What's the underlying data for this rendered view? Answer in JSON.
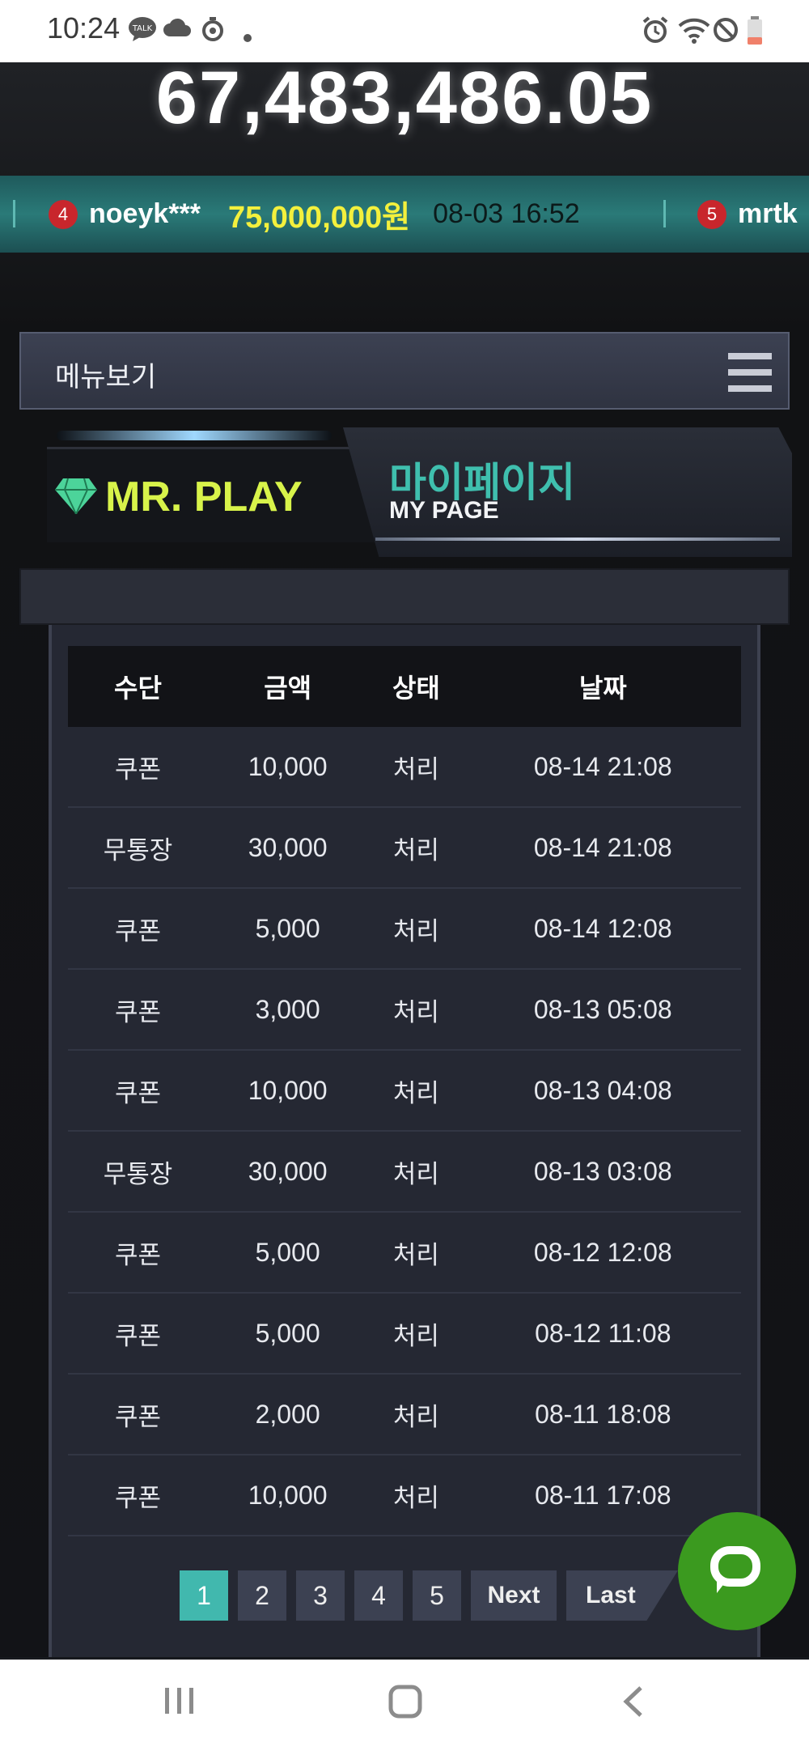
{
  "status_bar": {
    "time": "10:24",
    "icons_left": [
      "talk-icon",
      "cloud-icon",
      "timer-icon",
      "dot-icon"
    ],
    "icons_right": [
      "alarm-icon",
      "wifi-icon",
      "blocked-icon",
      "battery-icon"
    ]
  },
  "jackpot": {
    "value": "67,483,486.05"
  },
  "ticker": {
    "items": [
      {
        "rank": "4",
        "user": "noeyk***",
        "amount": "75,000,000원",
        "date": "08-03 16:52"
      },
      {
        "rank": "5",
        "user": "mrtk"
      }
    ]
  },
  "menu": {
    "label": "메뉴보기"
  },
  "brand": {
    "logo_text": "MR. PLAY",
    "page_title_kr": "마이페이지",
    "page_title_en": "MY PAGE"
  },
  "table": {
    "headers": [
      "수단",
      "금액",
      "상태",
      "날짜"
    ],
    "rows": [
      [
        "쿠폰",
        "10,000",
        "처리",
        "08-14 21:08"
      ],
      [
        "무통장",
        "30,000",
        "처리",
        "08-14 21:08"
      ],
      [
        "쿠폰",
        "5,000",
        "처리",
        "08-14 12:08"
      ],
      [
        "쿠폰",
        "3,000",
        "처리",
        "08-13 05:08"
      ],
      [
        "쿠폰",
        "10,000",
        "처리",
        "08-13 04:08"
      ],
      [
        "무통장",
        "30,000",
        "처리",
        "08-13 03:08"
      ],
      [
        "쿠폰",
        "5,000",
        "처리",
        "08-12 12:08"
      ],
      [
        "쿠폰",
        "5,000",
        "처리",
        "08-12 11:08"
      ],
      [
        "쿠폰",
        "2,000",
        "처리",
        "08-11 18:08"
      ],
      [
        "쿠폰",
        "10,000",
        "처리",
        "08-11 17:08"
      ]
    ]
  },
  "pagination": {
    "pages": [
      "1",
      "2",
      "3",
      "4",
      "5"
    ],
    "active": "1",
    "next": "Next",
    "last": "Last"
  },
  "colors": {
    "accent_teal": "#41b8ae",
    "logo_yellow": "#d8f34a",
    "ticker_amount": "#f3f03d",
    "chat_green": "#3b9a1f"
  }
}
